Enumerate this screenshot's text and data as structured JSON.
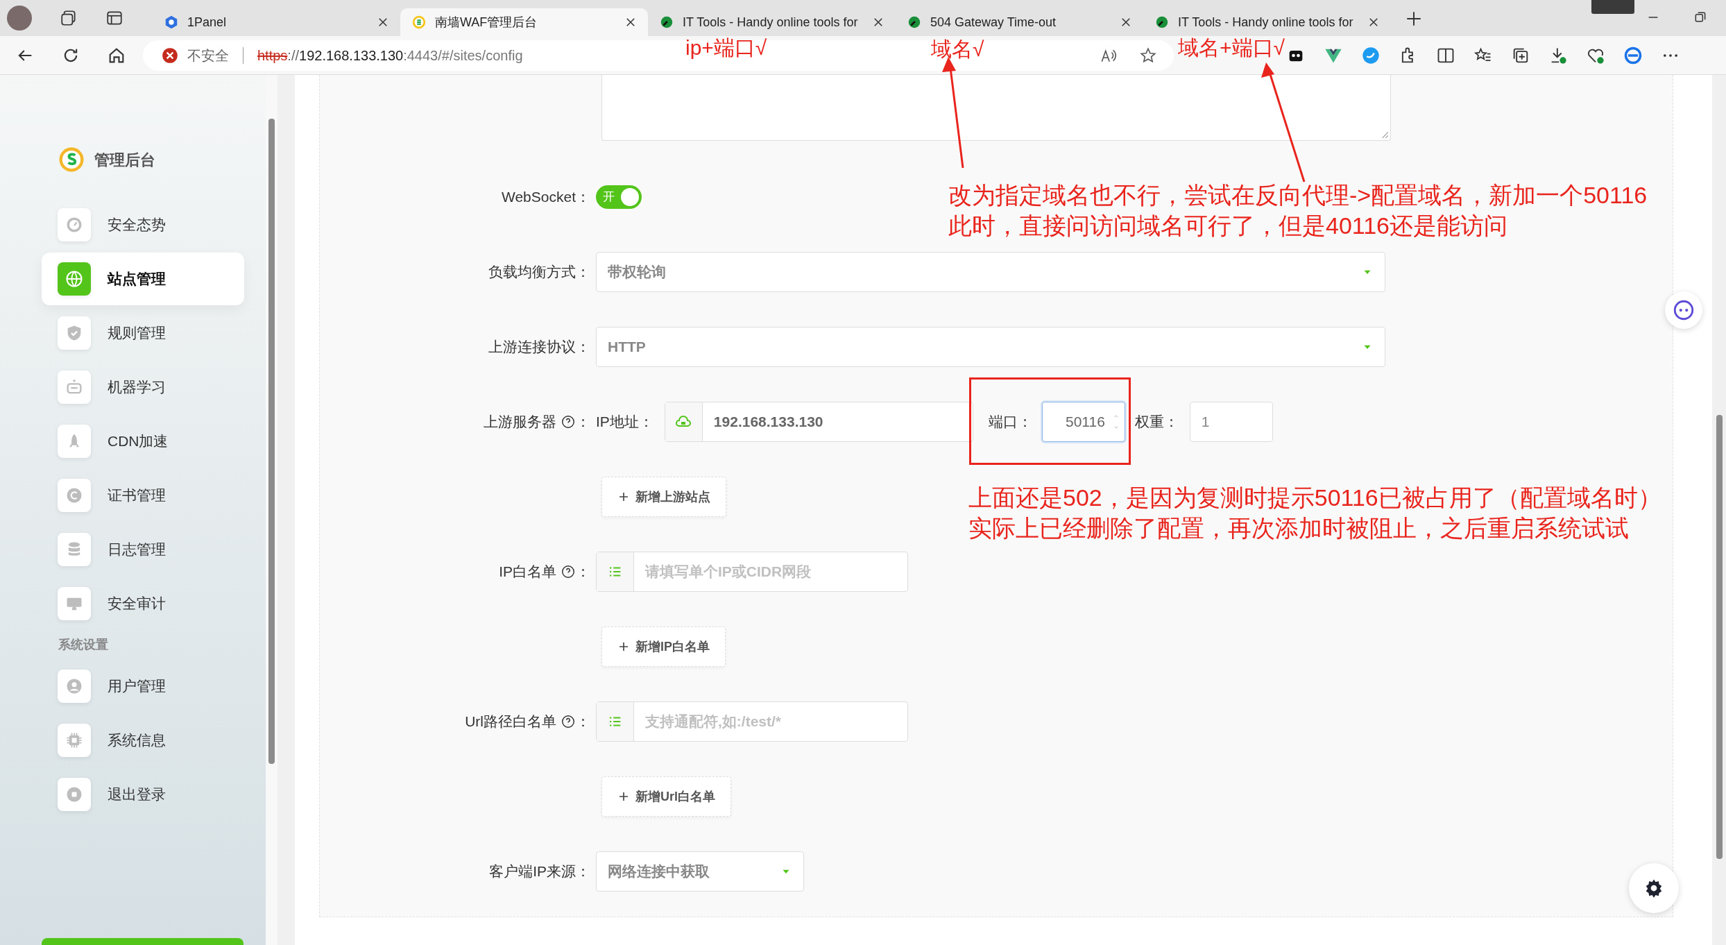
{
  "browser": {
    "tabs": [
      {
        "title": "1Panel",
        "selected": false
      },
      {
        "title": "南墙WAF管理后台",
        "selected": true
      },
      {
        "title": "IT Tools - Handy online tools for",
        "selected": false
      },
      {
        "title": "504 Gateway Time-out",
        "selected": false
      },
      {
        "title": "IT Tools - Handy online tools for",
        "selected": false
      }
    ],
    "security": "不安全",
    "url_scheme": "https",
    "url_sep": "://",
    "url_host": "192.168.133.130",
    "url_rest": ":4443/#/sites/config"
  },
  "sidebar": {
    "title": "管理后台",
    "items": [
      {
        "label": "安全态势",
        "selected": false
      },
      {
        "label": "站点管理",
        "selected": true
      },
      {
        "label": "规则管理",
        "selected": false
      },
      {
        "label": "机器学习",
        "selected": false
      },
      {
        "label": "CDN加速",
        "selected": false
      },
      {
        "label": "证书管理",
        "selected": false
      },
      {
        "label": "日志管理",
        "selected": false
      },
      {
        "label": "安全审计",
        "selected": false
      }
    ],
    "section": "系统设置",
    "section_items": [
      {
        "label": "用户管理",
        "selected": false
      },
      {
        "label": "系统信息",
        "selected": false
      },
      {
        "label": "退出登录",
        "selected": false
      }
    ]
  },
  "form": {
    "rows": [
      {
        "kind": "textarea"
      },
      {
        "kind": "switch",
        "label": "WebSocket：",
        "on": true,
        "switch_text": "开"
      },
      {
        "kind": "select",
        "label": "负载均衡方式：",
        "value": "带权轮询"
      },
      {
        "kind": "select",
        "label": "上游连接协议：",
        "value": "HTTP"
      },
      {
        "kind": "server",
        "label": "上游服务器",
        "suffix": "：",
        "ip_label": "IP地址：",
        "ip": "192.168.133.130",
        "port_label": "端口：",
        "port": "50116",
        "port_focused": true,
        "weight_label": "权重：",
        "weight": "1"
      },
      {
        "kind": "button",
        "label": "新增上游站点"
      },
      {
        "kind": "list",
        "label": "IP白名单",
        "suffix": "：",
        "placeholder": "请填写单个IP或CIDR网段"
      },
      {
        "kind": "button",
        "label": "新增IP白名单"
      },
      {
        "kind": "list",
        "label": "Url路径白名单",
        "suffix": "：",
        "placeholder": "支持通配符,如:/test/*"
      },
      {
        "kind": "button",
        "label": "新增Url白名单"
      },
      {
        "kind": "dropdown",
        "label": "客户端IP来源：",
        "value": "网络连接中获取"
      }
    ]
  },
  "annotations": [
    {
      "text": "ip+端口√"
    },
    {
      "text": "域名√"
    },
    {
      "text": "域名+端口√"
    },
    {
      "text": "改为指定域名也不行，尝试在反向代理->配置域名，新加一个50116"
    },
    {
      "text": "此时，直接问访问域名可行了，但是40116还是能访问"
    },
    {
      "text": "上面还是502，是因为复测时提示50116已被占用了（配置域名时）"
    },
    {
      "text": "实际上已经删除了配置，再次添加时被阻止，之后重启系统试试"
    }
  ]
}
